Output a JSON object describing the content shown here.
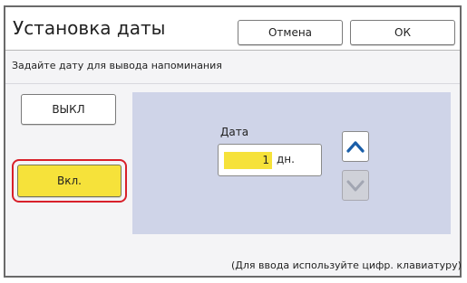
{
  "dialog": {
    "title": "Установка даты",
    "cancel_label": "Отмена",
    "ok_label": "ОК",
    "instruction": "Задайте дату для вывода напоминания"
  },
  "options": {
    "off_label": "ВЫКЛ",
    "on_label": "Вкл.",
    "selected": "on"
  },
  "date_panel": {
    "label": "Дата",
    "value": "1",
    "unit": "дн.",
    "up_icon": "chevron-up-icon",
    "down_icon": "chevron-down-icon"
  },
  "hint": "(Для ввода используйте цифр. клавиатуру)",
  "colors": {
    "accent_yellow": "#f6e23a",
    "highlight_red": "#d8202a",
    "arrow_blue": "#1a5ea8",
    "panel_blue": "#cfd4e8"
  }
}
